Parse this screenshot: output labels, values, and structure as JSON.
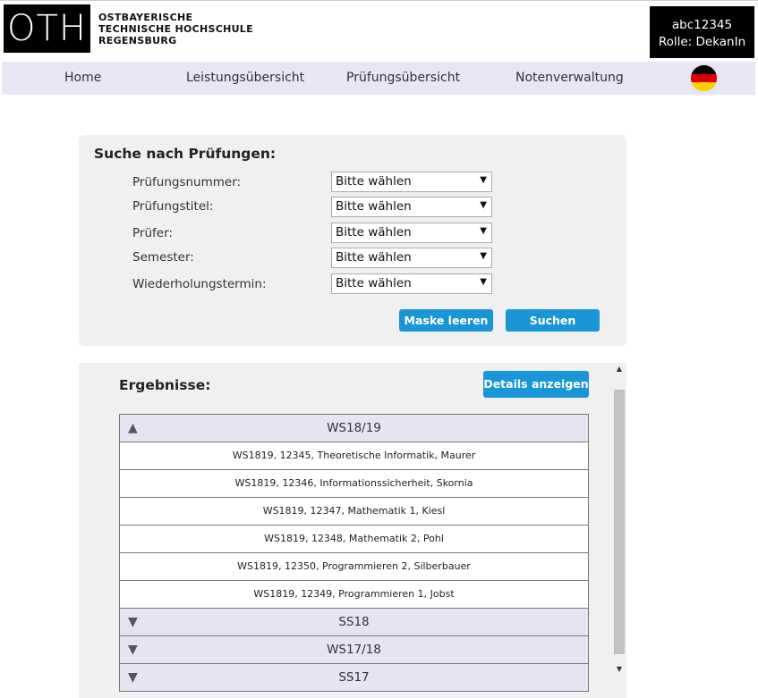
{
  "header": {
    "logo_text": "OTH",
    "university_lines": [
      "OSTBAYERISCHE",
      "TECHNISCHE HOCHSCHULE",
      "REGENSBURG"
    ],
    "user_id": "abc12345",
    "user_role": "Rolle: DekanIn"
  },
  "nav": {
    "items": [
      "Home",
      "Leistungsübersicht",
      "Prüfungsübersicht",
      "Notenverwaltung"
    ],
    "language_icon": "german-flag-icon"
  },
  "search": {
    "title": "Suche nach Prüfungen:",
    "fields": [
      {
        "label": "Prüfungsnummer:",
        "value": "Bitte wählen"
      },
      {
        "label": "Prüfungstitel:",
        "value": "Bitte wählen"
      },
      {
        "label": "Prüfer:",
        "value": "Bitte wählen"
      },
      {
        "label": "Semester:",
        "value": "Bitte wählen"
      },
      {
        "label": "Wiederholungstermin:",
        "value": "Bitte wählen"
      }
    ],
    "clear_label": "Maske leeren",
    "search_label": "Suchen"
  },
  "results": {
    "title": "Ergebnisse:",
    "details_label": "Details anzeigen",
    "groups": [
      {
        "label": "WS18/19",
        "expanded": true
      },
      {
        "label": "SS18",
        "expanded": false
      },
      {
        "label": "WS17/18",
        "expanded": false
      },
      {
        "label": "SS17",
        "expanded": false
      }
    ],
    "rows": [
      "WS1819, 12345, Theoretische Informatik, Maurer",
      "WS1819, 12346, Informationssicherheit, Skornia",
      "WS1819, 12347, Mathematik 1, Kiesl",
      "WS1819, 12348, Mathematik 2, Pohl",
      "WS1819, 12350, Programmieren 2, Silberbauer",
      "WS1819, 12349, Programmieren 1, Jobst"
    ]
  },
  "colors": {
    "accent": "#1a96d6",
    "nav_bg": "#e7e6f5",
    "panel_bg": "#f0f0f0"
  }
}
